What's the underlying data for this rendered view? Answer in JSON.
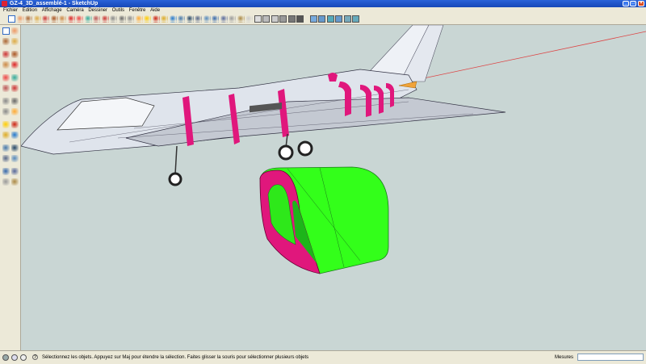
{
  "window": {
    "title": "GZ-4_3D_assemblé-1 - SketchUp",
    "min_label": "_",
    "max_label": "□",
    "close_label": "×"
  },
  "menu": {
    "items": [
      "Fichier",
      "Edition",
      "Affichage",
      "Caméra",
      "Dessiner",
      "Outils",
      "Fenêtre",
      "Aide"
    ]
  },
  "toolbar": {
    "tools": [
      "select-tool",
      "eraser-tool",
      "paint-bucket-tool",
      "rectangle-tool",
      "pencil-tool",
      "circle-tool",
      "arc-tool",
      "push-pull-tool",
      "follow-me-tool",
      "offset-tool",
      "move-tool",
      "rotate-tool",
      "scale-tool",
      "tape-measure-tool",
      "dimension-tool",
      "protractor-tool",
      "text-tool",
      "axes-tool",
      "3d-text-tool",
      "orbit-tool",
      "pan-tool",
      "zoom-tool",
      "zoom-window-tool",
      "zoom-extents-tool",
      "previous-view-tool",
      "position-camera-tool",
      "look-around-tool",
      "walk-tool",
      "section-plane-tool",
      "x-ray-style",
      "wireframe-style",
      "hidden-line-style",
      "shaded-style",
      "shaded-textures-style",
      "monochrome-style",
      "iso-view",
      "top-view",
      "front-view",
      "right-view",
      "back-view",
      "left-view"
    ]
  },
  "status": {
    "message": "Sélectionnez les objets. Appuyez sur Maj pour étendre la sélection. Faites glisser la souris pour sélectionner plusieurs objets",
    "measure_label": "Mesures",
    "measure_value": ""
  },
  "colors": {
    "accent_magenta": "#e0177c",
    "selection_green": "#33ff1a",
    "viewport_bg": "#c9d6d4",
    "title_blue": "#1a4fc4"
  }
}
